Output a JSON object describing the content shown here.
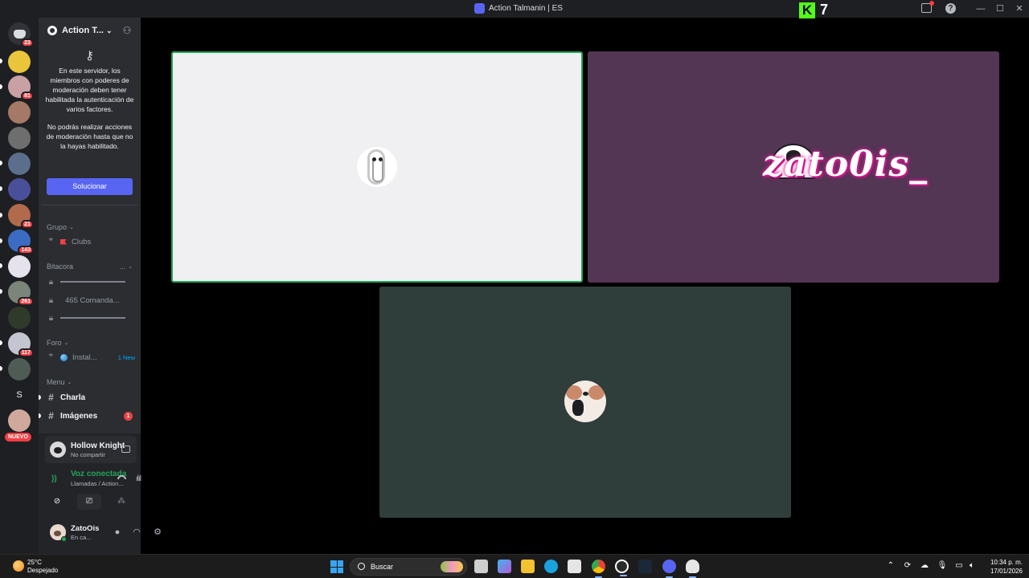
{
  "window": {
    "title": "Action Talmanin | ES",
    "kick_logo": "K",
    "kick_count": "7",
    "help_icon": "?"
  },
  "server_rail": {
    "home_badge": "23",
    "badges": [
      "81",
      "21",
      "143",
      "261",
      "117"
    ],
    "letter_server": "S",
    "new_label": "NUEVO"
  },
  "sidebar": {
    "server_name": "Action T...",
    "mfa_notice_1": "En este servidor, los miembros con poderes de moderación deben tener habilitada la autenticación de varios factores.",
    "mfa_notice_2": "No podrás realizar acciones de moderación hasta que no la hayas habilitado.",
    "fix_button": "Solucionar",
    "categories": {
      "grupo": "Grupo",
      "bitacora": "Bitacora",
      "bitacora_more": "...",
      "foro": "Foro",
      "menu": "Menu"
    },
    "channels": {
      "clubs": "Clubs",
      "comandas": "465 Comanda...",
      "install": "Instal...",
      "install_new": "1 New",
      "charla": "Charla",
      "imagenes": "Imágenes",
      "imagenes_mentions": "1"
    }
  },
  "panel": {
    "game_name": "Hollow Knight",
    "game_status": "No compartir",
    "voice_title": "Voz conectada",
    "voice_channel": "Llamadas / Action...",
    "user_name": "ZatoOis",
    "user_status": "En ca..."
  },
  "stage": {
    "banner_text": "zato0is_"
  },
  "taskbar": {
    "temperature": "25°C",
    "weather": "Despejado",
    "search_label": "Buscar",
    "time": "10:34 p. m.",
    "date": "17/01/2026"
  },
  "colors": {
    "blurple": "#5865f2",
    "green": "#23a55a",
    "red": "#f23f43",
    "kick_green": "#53fc18",
    "tile_light": "#f0f0f2",
    "tile_purple": "#533554",
    "tile_teal": "#2f3e3b"
  }
}
